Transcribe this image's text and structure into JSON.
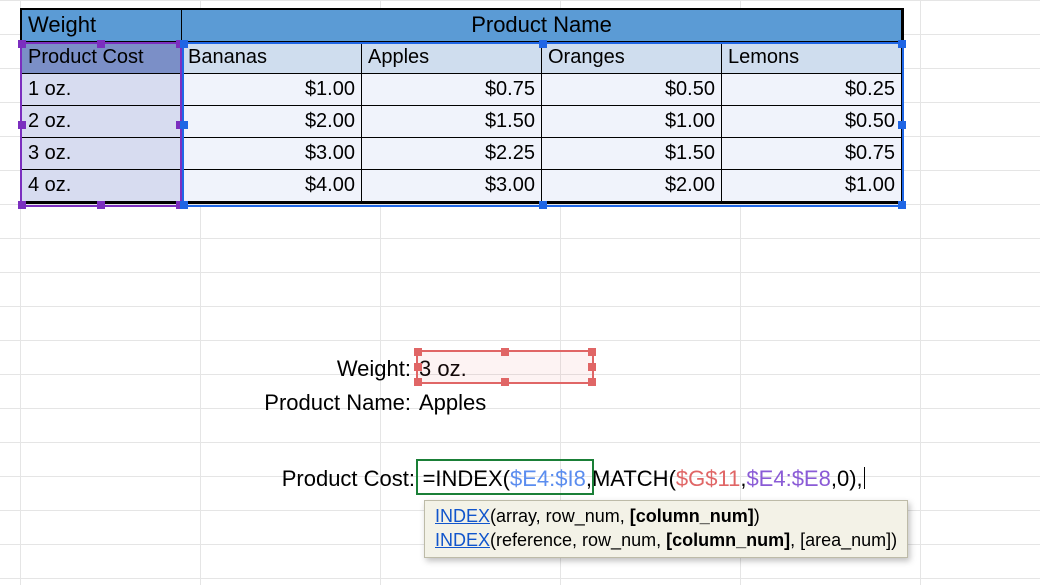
{
  "chart_data": {
    "type": "table",
    "row_headers": [
      "1 oz.",
      "2 oz.",
      "3 oz.",
      "4 oz."
    ],
    "col_headers": [
      "Bananas",
      "Apples",
      "Oranges",
      "Lemons"
    ],
    "values": [
      [
        "$1.00",
        "$0.75",
        "$0.50",
        "$0.25"
      ],
      [
        "$2.00",
        "$1.50",
        "$1.00",
        "$0.50"
      ],
      [
        "$3.00",
        "$2.25",
        "$1.50",
        "$0.75"
      ],
      [
        "$4.00",
        "$3.00",
        "$2.00",
        "$1.00"
      ]
    ],
    "corner_label": "Product Cost",
    "row_axis_label": "Weight",
    "col_axis_label": "Product Name"
  },
  "table": {
    "top_left": "Weight",
    "top_right": "Product Name",
    "corner": "Product Cost",
    "cols": [
      "Bananas",
      "Apples",
      "Oranges",
      "Lemons"
    ],
    "rows": [
      {
        "label": "1 oz.",
        "vals": [
          "$1.00",
          "$0.75",
          "$0.50",
          "$0.25"
        ]
      },
      {
        "label": "2 oz.",
        "vals": [
          "$2.00",
          "$1.50",
          "$1.00",
          "$0.50"
        ]
      },
      {
        "label": "3 oz.",
        "vals": [
          "$3.00",
          "$2.25",
          "$1.50",
          "$0.75"
        ]
      },
      {
        "label": "4 oz.",
        "vals": [
          "$4.00",
          "$3.00",
          "$2.00",
          "$1.00"
        ]
      }
    ]
  },
  "lookup": {
    "weight_label": "Weight:",
    "weight_value": "3 oz.",
    "product_label": "Product Name:",
    "product_value": "Apples",
    "cost_label": "Product Cost:"
  },
  "formula": {
    "eq": "=",
    "fn1": "INDEX",
    "lp": "(",
    "rng1": "$E4:$I8",
    "comma": ",",
    "fn2": "MATCH",
    "rng2": "$G$11",
    "rng3": "$E4:$E8",
    "zero": "0",
    "rp": ")"
  },
  "tooltip": {
    "sig1_fn": "INDEX",
    "sig1_rest_a": "(array, row_num, ",
    "sig1_bold": "[column_num]",
    "sig1_rest_b": ")",
    "sig2_fn": "INDEX",
    "sig2_rest_a": "(reference, row_num, ",
    "sig2_bold": "[column_num]",
    "sig2_rest_b": ", [area_num])"
  }
}
